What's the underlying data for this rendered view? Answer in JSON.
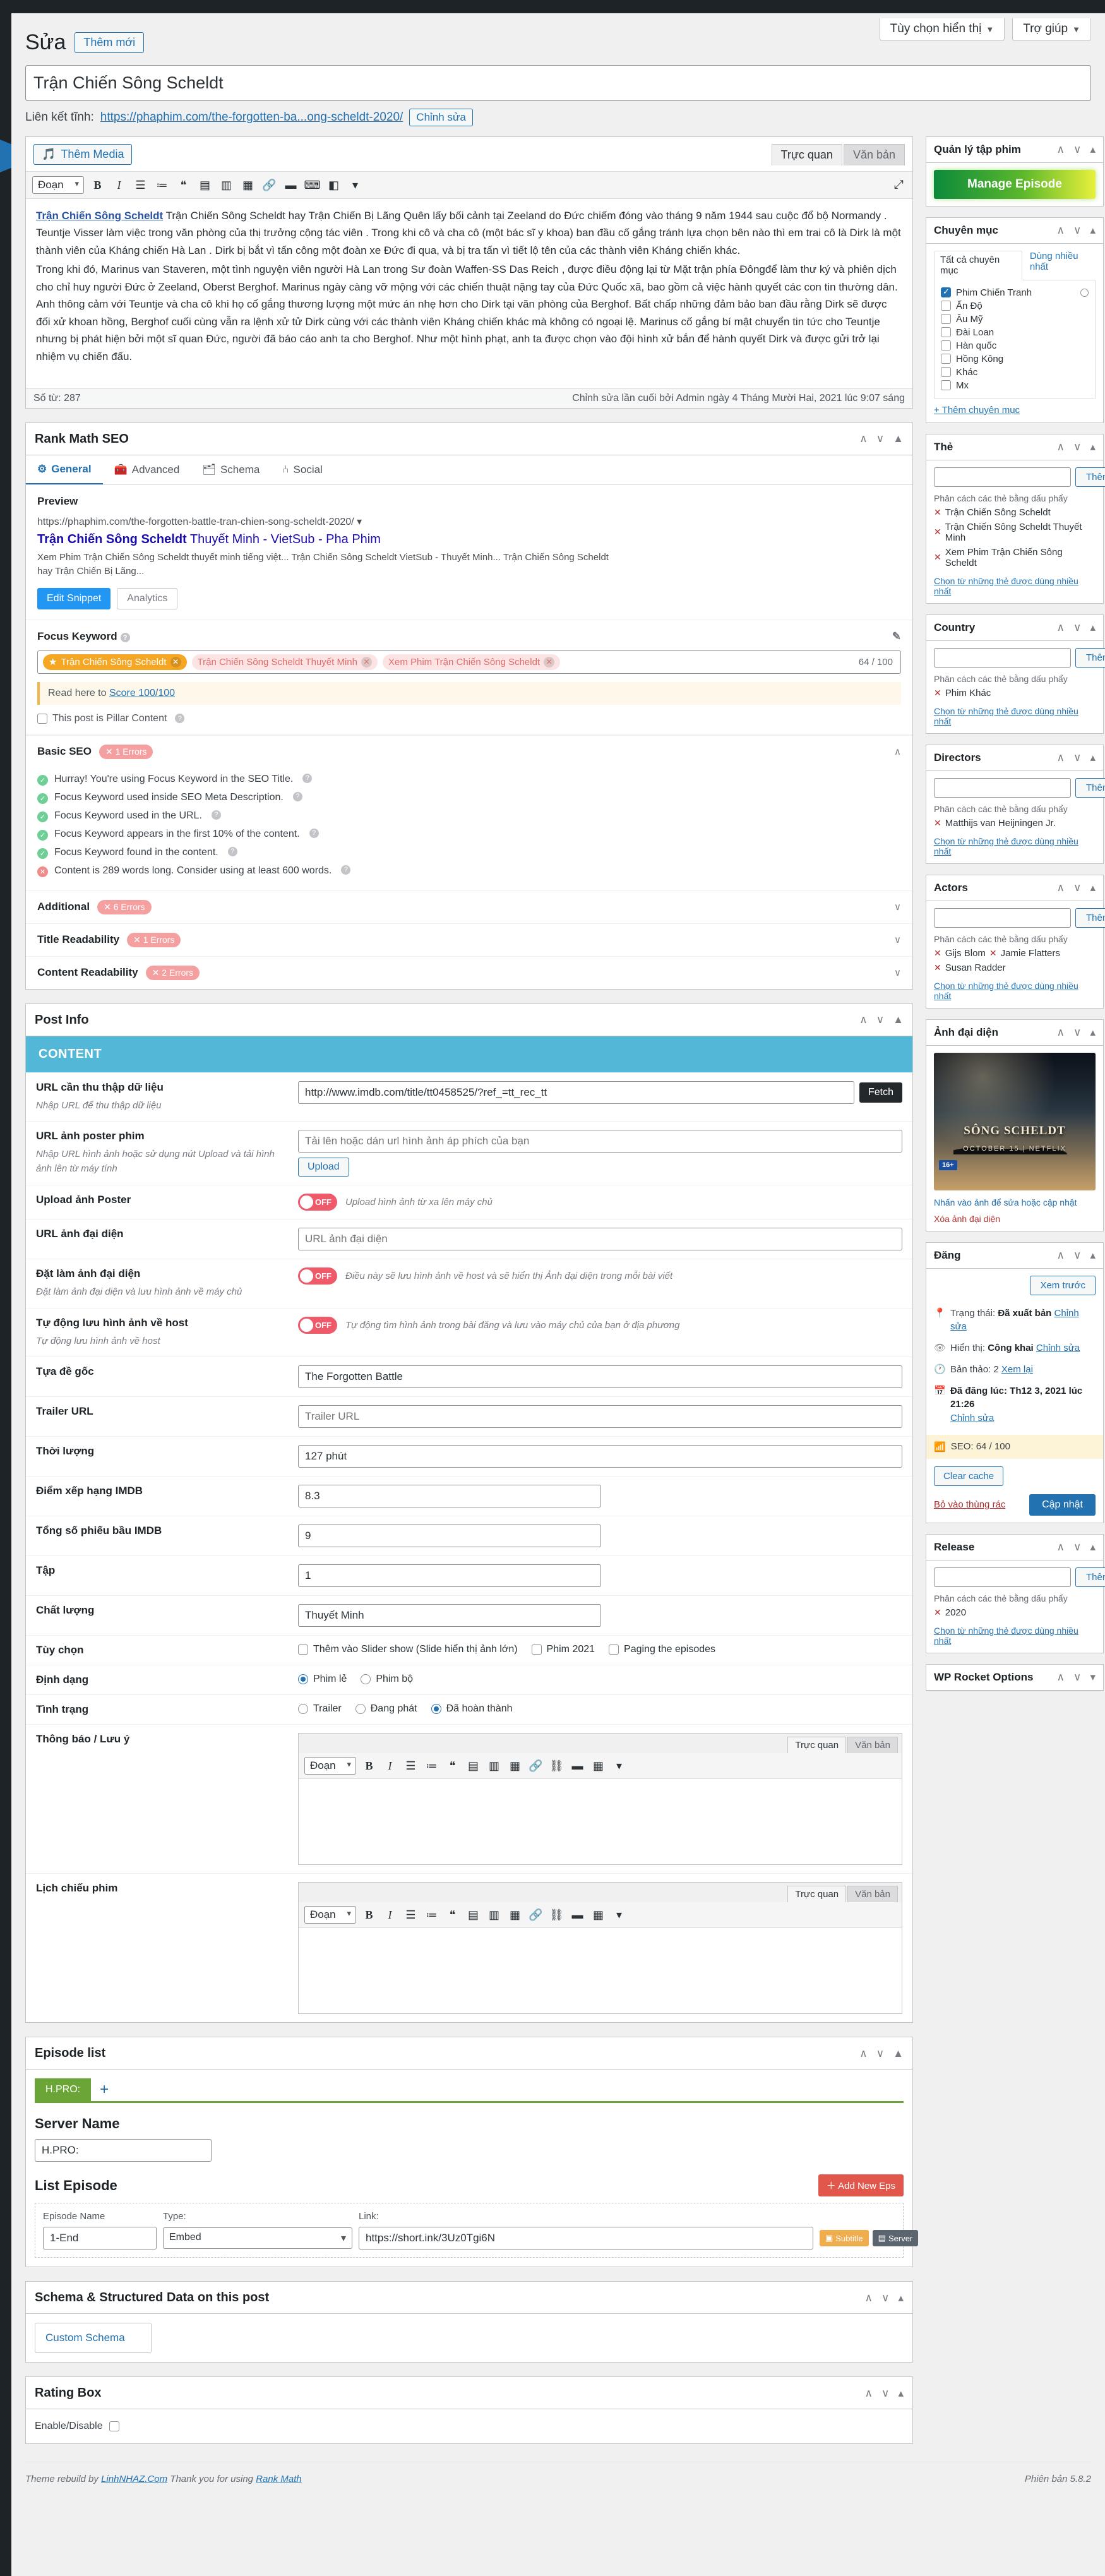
{
  "admin": {
    "screen_options": "Tùy chọn hiển thị",
    "help": "Trợ giúp",
    "page_title": "Sửa",
    "add_new": "Thêm mới"
  },
  "post": {
    "title": "Trận Chiến Sông Scheldt",
    "permalink_label": "Liên kết tĩnh:",
    "permalink_url": "https://phaphim.com/the-forgotten-ba...ong-scheldt-2020/",
    "edit_slug": "Chỉnh sửa"
  },
  "editor": {
    "add_media": "Thêm Media",
    "tab_visual": "Trực quan",
    "tab_text": "Văn bản",
    "format_select": "Đoạn",
    "word_count": "Số từ: 287",
    "last_edit": "Chỉnh sửa lần cuối bởi Admin ngày 4 Tháng Mười Hai, 2021 lúc 9:07 sáng",
    "body": [
      "Trận Chiến Sông Scheldt hay Trận Chiến Bị Lãng Quên lấy bối cảnh tại Zeeland do Đức chiếm đóng vào tháng 9 năm 1944 sau cuộc đổ bộ Normandy . Teuntje Visser làm việc trong văn phòng của thị trưởng cộng tác viên . Trong khi cô và cha cô (một bác sĩ y khoa) ban đầu cố gắng tránh lựa chọn bên nào thì em trai cô là Dirk là một thành viên của Kháng chiến Hà Lan . Dirk bị bắt vì tấn công một đoàn xe Đức đi qua, và bị tra tấn vì tiết lộ tên của các thành viên Kháng chiến khác.",
      "Trong khi đó, Marinus van Staveren, một tình nguyện viên người Hà Lan trong Sư đoàn Waffen-SS Das Reich , được điều động lại từ Mặt trận phía Đôngđể làm thư ký và phiên dịch cho chỉ huy người Đức ở Zeeland, Oberst Berghof. Marinus ngày càng vỡ mộng với các chiến thuật nặng tay của Đức Quốc xã, bao gồm cả việc hành quyết các con tin thường dân. Anh thông cảm với Teuntje và cha cô khi họ cố gắng thương lượng một mức án nhẹ hơn cho Dirk tại văn phòng của Berghof. Bất chấp những đảm bảo ban đầu rằng Dirk sẽ được đối xử khoan hồng, Berghof cuối cùng vẫn ra lệnh xử tử Dirk cùng với các thành viên Kháng chiến khác mà không có ngoại lệ. Marinus cố gắng bí mật chuyển tin tức cho Teuntje nhưng bị phát hiện bởi một sĩ quan Đức, người đã báo cáo anh ta cho Berghof. Như một hình phạt, anh ta được chọn vào đội hình xử bắn để hành quyết Dirk và được gửi trở lại nhiệm vụ chiến đấu."
    ]
  },
  "rank_math": {
    "panel_title": "Rank Math SEO",
    "tabs": [
      {
        "label": "General",
        "icon": "gear-icon",
        "active": true
      },
      {
        "label": "Advanced",
        "icon": "toolbox-icon",
        "active": false
      },
      {
        "label": "Schema",
        "icon": "schema-icon",
        "active": false
      },
      {
        "label": "Social",
        "icon": "share-icon",
        "active": false
      }
    ],
    "preview_label": "Preview",
    "snippet_url": "https://phaphim.com/the-forgotten-battle-tran-chien-song-scheldt-2020/",
    "snippet_title_bold": "Trận Chiến Sông Scheldt",
    "snippet_title_rest": " Thuyết Minh - VietSub - Pha Phim",
    "snippet_desc": "Xem Phim Trận Chiến Sông Scheldt thuyết minh tiếng việt... Trận Chiến Sông Scheldt VietSub - Thuyết Minh... Trận Chiến Sông Scheldt hay Trận Chiến Bị Lãng...",
    "edit_snippet": "Edit Snippet",
    "analytics": "Analytics",
    "focus_keyword_label": "Focus Keyword",
    "keywords": [
      {
        "text": "Trận Chiến Sông Scheldt",
        "primary": true
      },
      {
        "text": "Trận Chiến Sông Scheldt Thuyết Minh",
        "primary": false
      },
      {
        "text": "Xem Phim Trận Chiến Sông Scheldt",
        "primary": false
      }
    ],
    "kw_score": "64 / 100",
    "read_here": "Read here to",
    "score_link": "Score 100/100",
    "pillar_label": "This post is Pillar Content",
    "sections": [
      {
        "title": "Basic SEO",
        "errors": "1 Errors"
      },
      {
        "title": "Additional",
        "errors": "6 Errors"
      },
      {
        "title": "Title Readability",
        "errors": "1 Errors"
      },
      {
        "title": "Content Readability",
        "errors": "2 Errors"
      }
    ],
    "basic_checks": [
      {
        "status": "ok",
        "text": "Hurray! You're using Focus Keyword in the SEO Title."
      },
      {
        "status": "ok",
        "text": "Focus Keyword used inside SEO Meta Description."
      },
      {
        "status": "ok",
        "text": "Focus Keyword used in the URL."
      },
      {
        "status": "ok",
        "text": "Focus Keyword appears in the first 10% of the content."
      },
      {
        "status": "ok",
        "text": "Focus Keyword found in the content."
      },
      {
        "status": "bad",
        "text": "Content is 289 words long. Consider using at least 600 words."
      }
    ]
  },
  "post_info": {
    "panel_title": "Post Info",
    "banner": "CONTENT",
    "fields": [
      {
        "label": "URL cần thu thập dữ liệu",
        "desc": "Nhập URL để thu thập dữ liệu",
        "type": "input-fetch",
        "value": "http://www.imdb.com/title/tt0458525/?ref_=tt_rec_tt",
        "button": "Fetch"
      },
      {
        "label": "URL ảnh poster phim",
        "desc": "Nhập URL hình ảnh hoặc sử dụng nút Upload và tải hình ảnh lên từ máy tính",
        "type": "input-upload",
        "placeholder": "Tải lên hoặc dán url hình ảnh áp phích của bạn",
        "button": "Upload"
      },
      {
        "label": "Upload ảnh Poster",
        "desc": "",
        "type": "toggle",
        "state": "OFF",
        "note": "Upload hình ảnh từ xa lên máy chủ"
      },
      {
        "label": "URL ảnh đại diện",
        "desc": "",
        "type": "input",
        "placeholder": "URL ảnh đại diện"
      },
      {
        "label": "Đặt làm ảnh đại diện",
        "desc": "Đặt làm ảnh đại diện và lưu hình ảnh về máy chủ",
        "type": "toggle",
        "state": "OFF",
        "note": "Điều này sẽ lưu hình ảnh về host và sẽ hiển thị Ảnh đại diện trong mỗi bài viết"
      },
      {
        "label": "Tự động lưu hình ảnh về host",
        "desc": "Tự động lưu hình ảnh về host",
        "type": "toggle",
        "state": "OFF",
        "note": "Tự động tìm hình ảnh trong bài đăng và lưu vào máy chủ của bạn ở địa phương"
      },
      {
        "label": "Tựa đề gốc",
        "desc": "",
        "type": "input",
        "value": "The Forgotten Battle"
      },
      {
        "label": "Trailer URL",
        "desc": "",
        "type": "input",
        "placeholder": "Trailer URL"
      },
      {
        "label": "Thời lượng",
        "desc": "",
        "type": "input",
        "value": "127 phút"
      },
      {
        "label": "Điểm xếp hạng IMDB",
        "desc": "",
        "type": "input-sm",
        "value": "8.3"
      },
      {
        "label": "Tổng số phiếu bầu IMDB",
        "desc": "",
        "type": "input-sm",
        "value": "9"
      },
      {
        "label": "Tập",
        "desc": "",
        "type": "input-sm",
        "value": "1"
      },
      {
        "label": "Chất lượng",
        "desc": "",
        "type": "input-sm",
        "value": "Thuyết Minh"
      }
    ],
    "options_label": "Tùy chọn",
    "options": [
      {
        "label": "Thêm vào Slider show (Slide hiển thị ảnh lớn)",
        "checked": false
      },
      {
        "label": "Phim 2021",
        "checked": false
      },
      {
        "label": "Paging the episodes",
        "checked": false
      }
    ],
    "format_label": "Định dạng",
    "formats": [
      {
        "label": "Phim lẻ",
        "selected": true
      },
      {
        "label": "Phim bộ",
        "selected": false
      }
    ],
    "status_label": "Tình trạng",
    "statuses": [
      {
        "label": "Trailer",
        "selected": false
      },
      {
        "label": "Đang phát",
        "selected": false
      },
      {
        "label": "Đã hoàn thành",
        "selected": true
      }
    ],
    "notice_label": "Thông báo / Lưu ý",
    "schedule_label": "Lịch chiếu phim",
    "mini_tab_visual": "Trực quan",
    "mini_tab_text": "Văn bản",
    "mini_format": "Đoạn"
  },
  "episode_list": {
    "panel_title": "Episode list",
    "server_tab": "H.PRO:",
    "add_server": "+",
    "server_name_label": "Server Name",
    "server_name_value": "H.PRO:",
    "list_episode_label": "List Episode",
    "add_new_button": "＋ Add New Eps",
    "columns": {
      "name": "Episode Name",
      "type": "Type:",
      "link": "Link:"
    },
    "rows": [
      {
        "name": "1-End",
        "type": "Embed",
        "link": "https://short.ink/3Uz0Tgi6N",
        "btn_sub": "Subtitle",
        "btn_server": "Server"
      }
    ]
  },
  "schema_box": {
    "panel_title": "Schema & Structured Data on this post",
    "custom_schema": "Custom Schema"
  },
  "rating_box": {
    "panel_title": "Rating Box",
    "enable_label": "Enable/Disable"
  },
  "sidebar": {
    "manage_episode": {
      "title": "Quản lý tập phim",
      "button": "Manage Episode"
    },
    "categories": {
      "title": "Chuyên mục",
      "tab_all": "Tất cả chuyên mục",
      "tab_most": "Dùng nhiều nhất",
      "items": [
        {
          "label": "Phim Chiến Tranh",
          "checked": true,
          "radio": true
        },
        {
          "label": "Ấn Độ",
          "checked": false
        },
        {
          "label": "Âu Mỹ",
          "checked": false
        },
        {
          "label": "Đài Loan",
          "checked": false
        },
        {
          "label": "Hàn quốc",
          "checked": false
        },
        {
          "label": "Hồng Kông",
          "checked": false
        },
        {
          "label": "Khác",
          "checked": false
        },
        {
          "label": "Mx",
          "checked": false
        }
      ],
      "add_link": "+ Thêm chuyên mục"
    },
    "tags": {
      "title": "Thẻ",
      "add_button": "Thêm",
      "hint": "Phân cách các thẻ bằng dấu phẩy",
      "items": [
        "Trận Chiến Sông Scheldt",
        "Trận Chiến Sông Scheldt Thuyết Minh",
        "Xem Phim Trận Chiến Sông Scheldt"
      ],
      "choose_link": "Chọn từ những thẻ được dùng nhiều nhất"
    },
    "country": {
      "title": "Country",
      "add_button": "Thêm",
      "hint": "Phân cách các thẻ bằng dấu phẩy",
      "items": [
        "Phim Khác"
      ],
      "choose_link": "Chọn từ những thẻ được dùng nhiều nhất"
    },
    "directors": {
      "title": "Directors",
      "add_button": "Thêm",
      "hint": "Phân cách các thẻ bằng dấu phẩy",
      "items": [
        "Matthijs van Heijningen Jr."
      ],
      "choose_link": "Chọn từ những thẻ được dùng nhiều nhất"
    },
    "actors": {
      "title": "Actors",
      "add_button": "Thêm",
      "hint": "Phân cách các thẻ bằng dấu phẩy",
      "items": [
        "Gijs Blom",
        "Jamie Flatters",
        "Susan Radder"
      ],
      "choose_link": "Chọn từ những thẻ được dùng nhiều nhất"
    },
    "featured": {
      "title": "Ảnh đại diện",
      "poster_title": "SÔNG SCHELDT",
      "poster_sub": "OCTOBER 15 | NETFLIX",
      "poster_badge": "16+",
      "note": "Nhấn vào ảnh để sửa hoặc cập nhật",
      "remove": "Xóa ảnh đại diện"
    },
    "publish": {
      "title": "Đăng",
      "preview": "Xem trước",
      "status_label": "Trạng thái:",
      "status_value": "Đã xuất bản",
      "status_edit": "Chỉnh sửa",
      "visibility_label": "Hiển thị:",
      "visibility_value": "Công khai",
      "visibility_edit": "Chỉnh sửa",
      "revisions_label": "Bản thảo: 2",
      "revisions_link": "Xem lại",
      "published_label": "Đã đăng lúc: Th12 3, 2021 lúc 21:26",
      "published_edit": "Chỉnh sửa",
      "seo_score": "SEO: 64 / 100",
      "clear_cache": "Clear cache",
      "trash": "Bỏ vào thùng rác",
      "update": "Cập nhật"
    },
    "release": {
      "title": "Release",
      "add_button": "Thêm",
      "hint": "Phân cách các thẻ bằng dấu phẩy",
      "items": [
        "2020"
      ],
      "choose_link": "Chọn từ những thẻ được dùng nhiều nhất"
    },
    "wp_rocket": {
      "title": "WP Rocket Options"
    }
  },
  "footer": {
    "left_a": "Theme rebuild by",
    "left_link": "LinhNHAZ.Com",
    "left_b": "Thank you for using",
    "left_link2": "Rank Math",
    "right": "Phiên bản 5.8.2"
  }
}
